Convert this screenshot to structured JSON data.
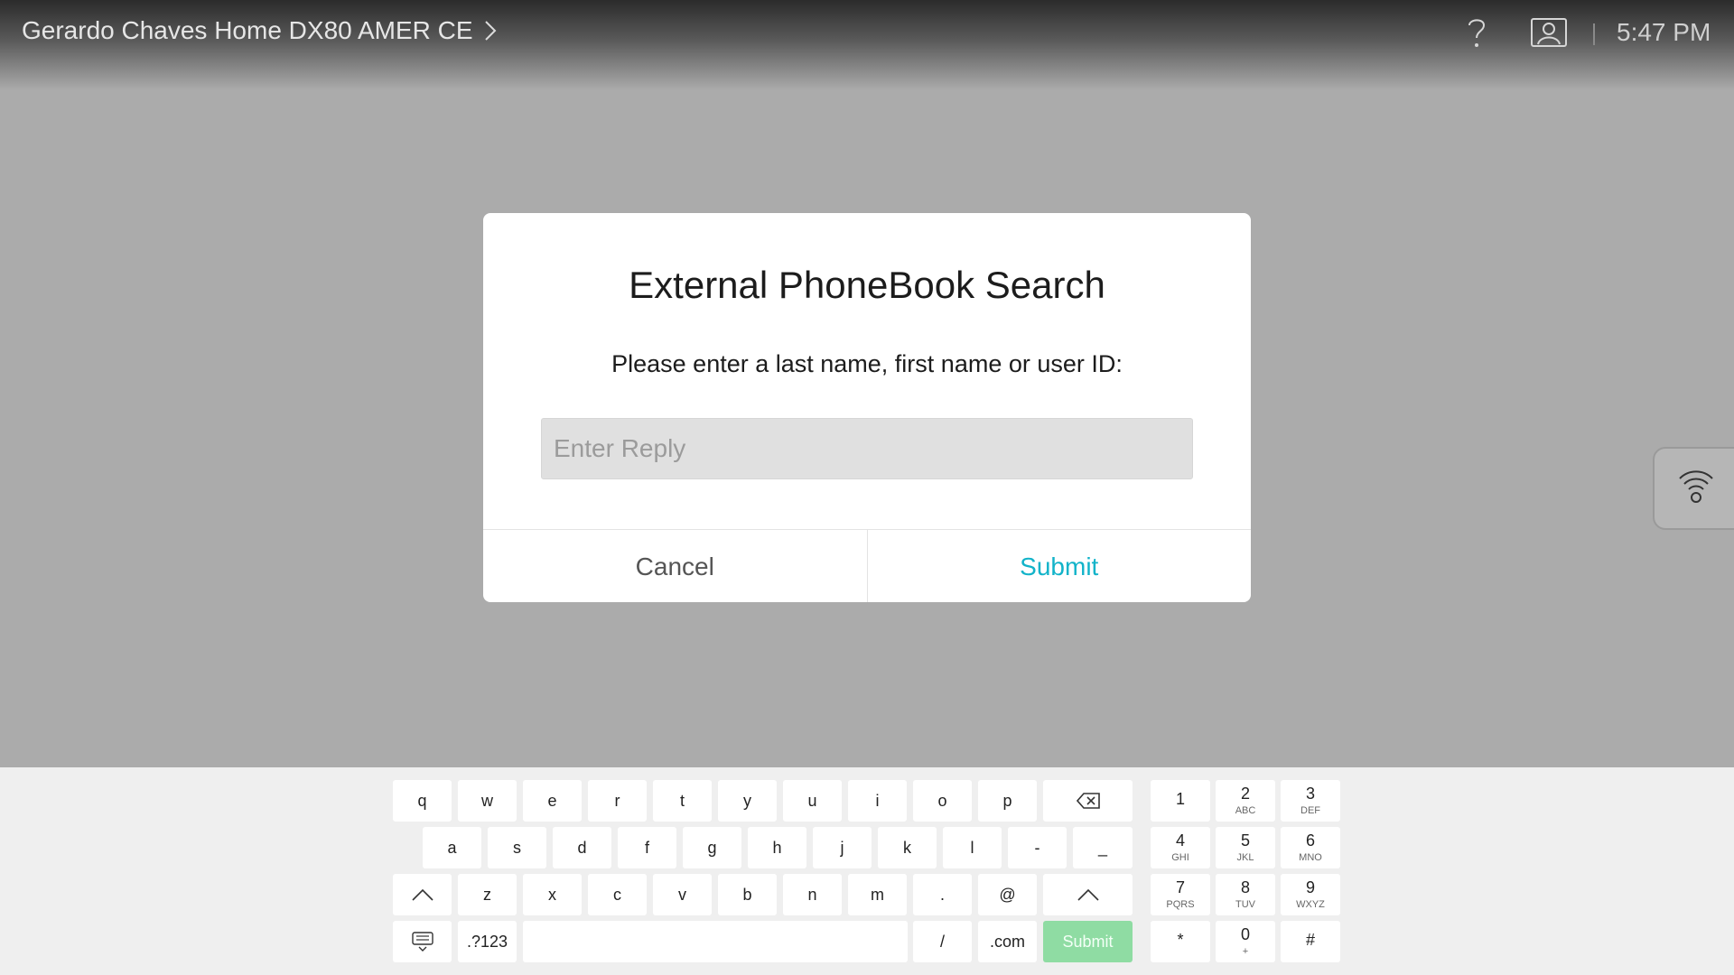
{
  "header": {
    "device_name": "Gerardo Chaves Home DX80 AMER CE",
    "time": "5:47 PM",
    "icons": [
      "chevron-right-icon",
      "help-icon",
      "contact-card-icon"
    ]
  },
  "side_panel": {
    "icon": "wireless-share-icon"
  },
  "dialog": {
    "title": "External PhoneBook Search",
    "prompt": "Please enter a last name, first name or user ID:",
    "input_placeholder": "Enter Reply",
    "input_value": "",
    "cancel_label": "Cancel",
    "submit_label": "Submit"
  },
  "keyboard": {
    "row1": [
      "q",
      "w",
      "e",
      "r",
      "t",
      "y",
      "u",
      "i",
      "o",
      "p"
    ],
    "row2": [
      "a",
      "s",
      "d",
      "f",
      "g",
      "h",
      "j",
      "k",
      "l",
      "-",
      "_"
    ],
    "row3": [
      "z",
      "x",
      "c",
      "v",
      "b",
      "n",
      "m",
      ".",
      "@"
    ],
    "row4": {
      "symbols_label": ".?123",
      "slash": "/",
      "dotcom": ".com",
      "submit_label": "Submit"
    },
    "special_icons": [
      "backspace-icon",
      "shift-icon",
      "hide-keyboard-icon"
    ],
    "numpad": [
      {
        "digit": "1",
        "letters": ""
      },
      {
        "digit": "2",
        "letters": "ABC"
      },
      {
        "digit": "3",
        "letters": "DEF"
      },
      {
        "digit": "4",
        "letters": "GHI"
      },
      {
        "digit": "5",
        "letters": "JKL"
      },
      {
        "digit": "6",
        "letters": "MNO"
      },
      {
        "digit": "7",
        "letters": "PQRS"
      },
      {
        "digit": "8",
        "letters": "TUV"
      },
      {
        "digit": "9",
        "letters": "WXYZ"
      },
      {
        "digit": "*",
        "letters": ""
      },
      {
        "digit": "0",
        "letters": "+"
      },
      {
        "digit": "#",
        "letters": ""
      }
    ]
  },
  "colors": {
    "accent": "#12b3c9",
    "submit_key": "#8fdca3",
    "backdrop": "#ababab",
    "keyboard_bg": "#efefef"
  }
}
